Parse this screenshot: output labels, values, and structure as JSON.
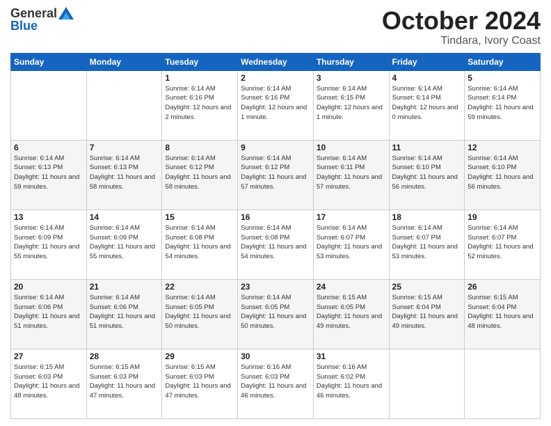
{
  "header": {
    "logo_general": "General",
    "logo_blue": "Blue",
    "month": "October 2024",
    "location": "Tindara, Ivory Coast"
  },
  "days_of_week": [
    "Sunday",
    "Monday",
    "Tuesday",
    "Wednesday",
    "Thursday",
    "Friday",
    "Saturday"
  ],
  "weeks": [
    [
      null,
      null,
      {
        "day": "1",
        "sunrise": "6:14 AM",
        "sunset": "6:16 PM",
        "daylight": "12 hours and 2 minutes."
      },
      {
        "day": "2",
        "sunrise": "6:14 AM",
        "sunset": "6:16 PM",
        "daylight": "12 hours and 1 minute."
      },
      {
        "day": "3",
        "sunrise": "6:14 AM",
        "sunset": "6:15 PM",
        "daylight": "12 hours and 1 minute."
      },
      {
        "day": "4",
        "sunrise": "6:14 AM",
        "sunset": "6:14 PM",
        "daylight": "12 hours and 0 minutes."
      },
      {
        "day": "5",
        "sunrise": "6:14 AM",
        "sunset": "6:14 PM",
        "daylight": "11 hours and 59 minutes."
      }
    ],
    [
      {
        "day": "6",
        "sunrise": "6:14 AM",
        "sunset": "6:13 PM",
        "daylight": "11 hours and 59 minutes."
      },
      {
        "day": "7",
        "sunrise": "6:14 AM",
        "sunset": "6:13 PM",
        "daylight": "11 hours and 58 minutes."
      },
      {
        "day": "8",
        "sunrise": "6:14 AM",
        "sunset": "6:12 PM",
        "daylight": "11 hours and 58 minutes."
      },
      {
        "day": "9",
        "sunrise": "6:14 AM",
        "sunset": "6:12 PM",
        "daylight": "11 hours and 57 minutes."
      },
      {
        "day": "10",
        "sunrise": "6:14 AM",
        "sunset": "6:11 PM",
        "daylight": "11 hours and 57 minutes."
      },
      {
        "day": "11",
        "sunrise": "6:14 AM",
        "sunset": "6:10 PM",
        "daylight": "11 hours and 56 minutes."
      },
      {
        "day": "12",
        "sunrise": "6:14 AM",
        "sunset": "6:10 PM",
        "daylight": "11 hours and 56 minutes."
      }
    ],
    [
      {
        "day": "13",
        "sunrise": "6:14 AM",
        "sunset": "6:09 PM",
        "daylight": "11 hours and 55 minutes."
      },
      {
        "day": "14",
        "sunrise": "6:14 AM",
        "sunset": "6:09 PM",
        "daylight": "11 hours and 55 minutes."
      },
      {
        "day": "15",
        "sunrise": "6:14 AM",
        "sunset": "6:08 PM",
        "daylight": "11 hours and 54 minutes."
      },
      {
        "day": "16",
        "sunrise": "6:14 AM",
        "sunset": "6:08 PM",
        "daylight": "11 hours and 54 minutes."
      },
      {
        "day": "17",
        "sunrise": "6:14 AM",
        "sunset": "6:07 PM",
        "daylight": "11 hours and 53 minutes."
      },
      {
        "day": "18",
        "sunrise": "6:14 AM",
        "sunset": "6:07 PM",
        "daylight": "11 hours and 53 minutes."
      },
      {
        "day": "19",
        "sunrise": "6:14 AM",
        "sunset": "6:07 PM",
        "daylight": "11 hours and 52 minutes."
      }
    ],
    [
      {
        "day": "20",
        "sunrise": "6:14 AM",
        "sunset": "6:06 PM",
        "daylight": "11 hours and 51 minutes."
      },
      {
        "day": "21",
        "sunrise": "6:14 AM",
        "sunset": "6:06 PM",
        "daylight": "11 hours and 51 minutes."
      },
      {
        "day": "22",
        "sunrise": "6:14 AM",
        "sunset": "6:05 PM",
        "daylight": "11 hours and 50 minutes."
      },
      {
        "day": "23",
        "sunrise": "6:14 AM",
        "sunset": "6:05 PM",
        "daylight": "11 hours and 50 minutes."
      },
      {
        "day": "24",
        "sunrise": "6:15 AM",
        "sunset": "6:05 PM",
        "daylight": "11 hours and 49 minutes."
      },
      {
        "day": "25",
        "sunrise": "6:15 AM",
        "sunset": "6:04 PM",
        "daylight": "11 hours and 49 minutes."
      },
      {
        "day": "26",
        "sunrise": "6:15 AM",
        "sunset": "6:04 PM",
        "daylight": "11 hours and 48 minutes."
      }
    ],
    [
      {
        "day": "27",
        "sunrise": "6:15 AM",
        "sunset": "6:03 PM",
        "daylight": "11 hours and 48 minutes."
      },
      {
        "day": "28",
        "sunrise": "6:15 AM",
        "sunset": "6:03 PM",
        "daylight": "11 hours and 47 minutes."
      },
      {
        "day": "29",
        "sunrise": "6:15 AM",
        "sunset": "6:03 PM",
        "daylight": "11 hours and 47 minutes."
      },
      {
        "day": "30",
        "sunrise": "6:16 AM",
        "sunset": "6:03 PM",
        "daylight": "11 hours and 46 minutes."
      },
      {
        "day": "31",
        "sunrise": "6:16 AM",
        "sunset": "6:02 PM",
        "daylight": "11 hours and 46 minutes."
      },
      null,
      null
    ]
  ]
}
